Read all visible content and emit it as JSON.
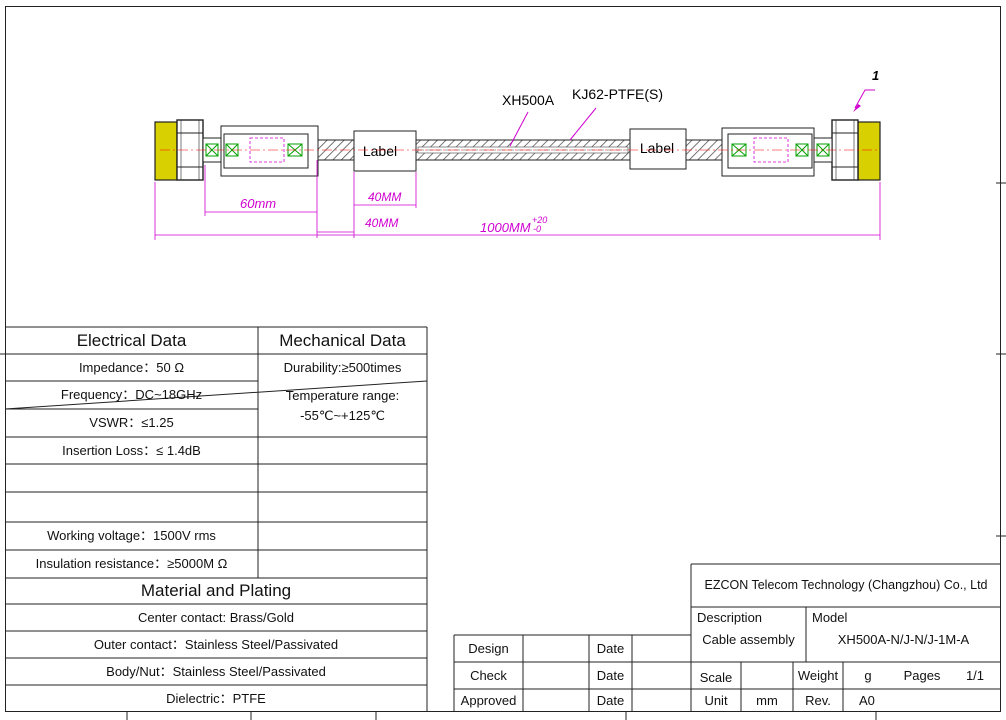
{
  "drawing": {
    "balloon_number": "1",
    "cable_label": "XH500A",
    "jacket_label": "KJ62-PTFE(S)",
    "label_left": "Label",
    "label_right": "Label",
    "dim_60": "60mm",
    "dim_40_a": "40MM",
    "dim_40_b": "40MM",
    "dim_length": "1000MM",
    "tol_plus": "+20",
    "tol_minus": "-0"
  },
  "spec_table": {
    "electrical_header": "Electrical Data",
    "mechanical_header": "Mechanical Data",
    "impedance": "Impedance：50 Ω",
    "frequency": "Frequency：DC~18GHz",
    "vswr": "VSWR：≤1.25",
    "insertion_loss": "Insertion Loss：≤ 1.4dB",
    "working_voltage": "Working voltage：1500V rms",
    "insulation_resistance": "Insulation resistance：≥5000M Ω",
    "durability": "Durability:≥500times",
    "temp_label": "Temperature range:",
    "temp_value": "-55℃~+125℃",
    "material_header": "Material and Plating",
    "center_contact": "Center contact: Brass/Gold",
    "outer_contact": "Outer contact：Stainless Steel/Passivated",
    "body_nut": "Body/Nut：Stainless Steel/Passivated",
    "dielectric": "Dielectric：PTFE"
  },
  "approval": {
    "design": "Design",
    "check": "Check",
    "approved": "Approved",
    "date": "Date"
  },
  "title_block": {
    "company": "EZCON Telecom Technology (Changzhou) Co., Ltd",
    "description_label": "Description",
    "description_value": "Cable assembly",
    "model_label": "Model",
    "model_value": "XH500A-N/J-N/J-1M-A",
    "scale_label": "Scale",
    "weight_label": "Weight",
    "weight_value": "g",
    "pages_label": "Pages",
    "pages_value": "1/1",
    "unit_label": "Unit",
    "unit_value": "mm",
    "rev_label": "Rev.",
    "rev_value": "A0"
  },
  "colors": {
    "dimension": "#d000d0",
    "connector_gold": "#d8d000",
    "cable_hatch": "#666666",
    "center_line": "#ff0000",
    "contact_green": "#00a000"
  }
}
